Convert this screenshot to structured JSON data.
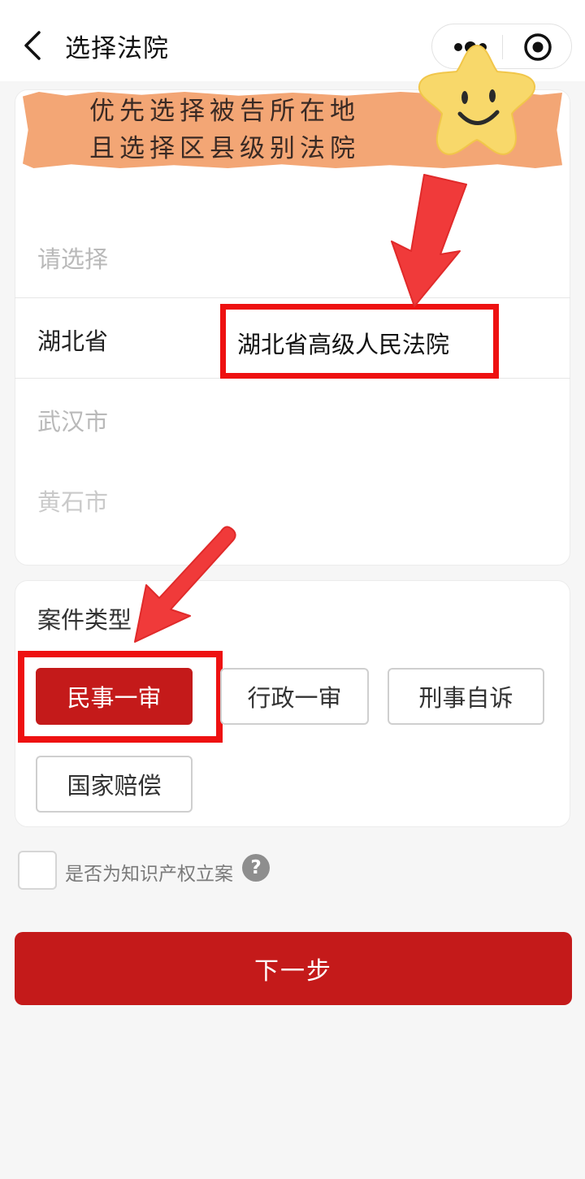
{
  "header": {
    "title": "选择法院",
    "back_icon": "chevron-left-icon",
    "more_icon": "more-dots-icon",
    "target_icon": "record-target-icon"
  },
  "annotation": {
    "line1": "优先选择被告所在地",
    "line2": "且选择区县级别法院",
    "tape_color": "#f3a675",
    "star_icon": "smiley-star-icon"
  },
  "picker": {
    "rows": [
      {
        "label": "请选择"
      },
      {
        "label": "湖北省"
      },
      {
        "label": "武汉市"
      },
      {
        "label": "黄石市"
      }
    ],
    "selected_court": "湖北省高级人民法院"
  },
  "case_type": {
    "title": "案件类型",
    "options": [
      {
        "label": "民事一审"
      },
      {
        "label": "行政一审"
      },
      {
        "label": "刑事自诉"
      },
      {
        "label": "国家赔偿"
      }
    ],
    "selected_index": 0
  },
  "ip_filing": {
    "label": "是否为知识产权立案",
    "help_icon": "question-mark-icon",
    "help_text": "?"
  },
  "next_button": {
    "label": "下一步"
  },
  "colors": {
    "brand_red": "#c41a1a",
    "highlight_red": "#ee1111",
    "arrow_red": "#f03a3a"
  }
}
